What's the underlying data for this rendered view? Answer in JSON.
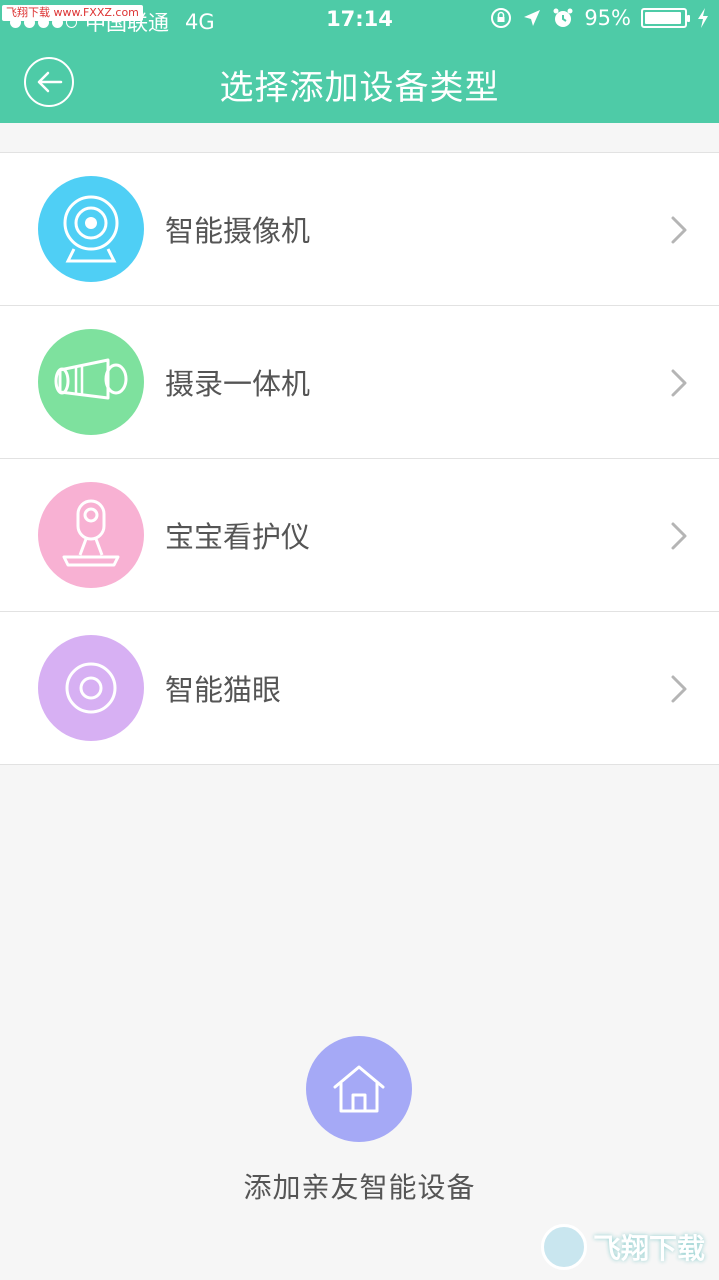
{
  "status_bar": {
    "watermark": "飞翔下载 www.FXXZ.com",
    "carrier": "中国联通",
    "network": "4G",
    "time": "17:14",
    "battery_percent": "95%",
    "battery_level": 0.95
  },
  "nav": {
    "title": "选择添加设备类型",
    "back_icon": "back-arrow-icon"
  },
  "devices": [
    {
      "label": "智能摄像机",
      "icon": "webcam-icon",
      "color": "#4fcff5"
    },
    {
      "label": "摄录一体机",
      "icon": "bullet-camera-icon",
      "color": "#7ee19e"
    },
    {
      "label": "宝宝看护仪",
      "icon": "baby-monitor-icon",
      "color": "#f8b1d3"
    },
    {
      "label": "智能猫眼",
      "icon": "peephole-icon",
      "color": "#d7b0f3"
    }
  ],
  "friend": {
    "label": "添加亲友智能设备",
    "icon": "home-icon",
    "color": "#a5a9f6"
  },
  "watermark_bottom": {
    "text": "飞翔下载"
  },
  "colors": {
    "header": "#4ecba7",
    "background": "#f6f6f6"
  }
}
